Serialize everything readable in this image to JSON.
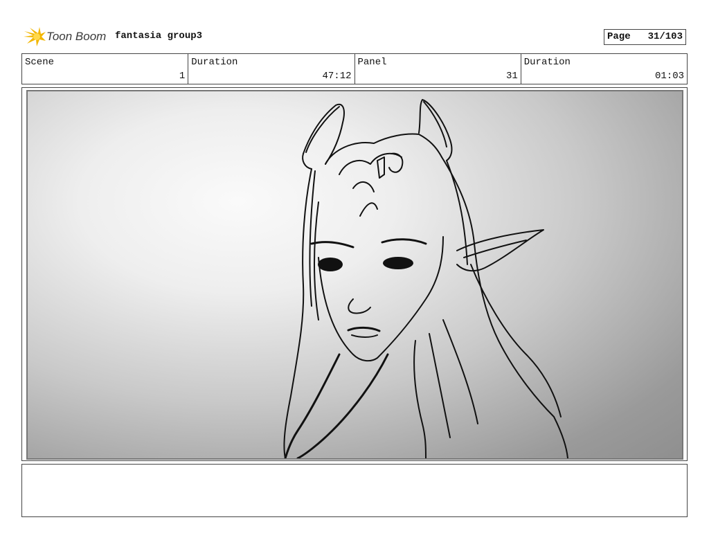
{
  "header": {
    "logo_text": "Toon Boom",
    "project_title": "fantasia group3",
    "page_label": "Page",
    "page_value": "31/103"
  },
  "info": {
    "scene_label": "Scene",
    "scene_value": "1",
    "duration_label": "Duration",
    "duration_value": "47:12",
    "panel_label": "Panel",
    "panel_value": "31",
    "panel_duration_label": "Duration",
    "panel_duration_value": "01:03"
  },
  "notes": {
    "text": ""
  }
}
